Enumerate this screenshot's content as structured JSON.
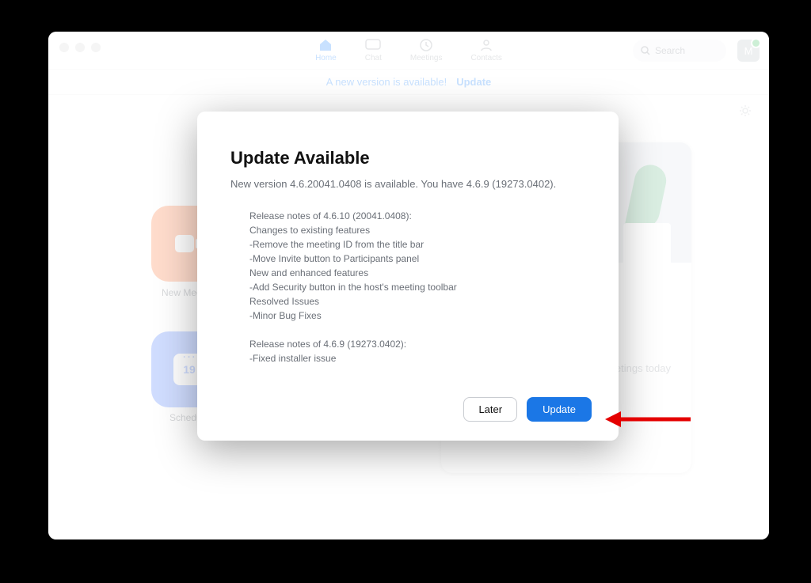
{
  "tabs": {
    "home": "Home",
    "chat": "Chat",
    "meetings": "Meetings",
    "contacts": "Contacts"
  },
  "search": {
    "placeholder": "Search"
  },
  "avatar": {
    "initial": "M"
  },
  "banner": {
    "text": "A new version is available!",
    "link": "Update"
  },
  "tiles": {
    "new_meeting": "New Meeting",
    "schedule": "Schedule",
    "calendar_day": "19"
  },
  "right": {
    "no_meetings": "No upcoming meetings today"
  },
  "modal": {
    "title": "Update Available",
    "subhead": "New version 4.6.20041.0408 is available. You have 4.6.9 (19273.0402).",
    "notes": "Release notes of 4.6.10 (20041.0408):\nChanges to existing features\n-Remove the meeting ID from the title bar\n-Move Invite button to Participants panel\nNew and enhanced features\n-Add Security button in the host's meeting toolbar\nResolved Issues\n-Minor Bug Fixes\n\nRelease notes of 4.6.9 (19273.0402):\n-Fixed installer issue",
    "later": "Later",
    "update": "Update"
  }
}
